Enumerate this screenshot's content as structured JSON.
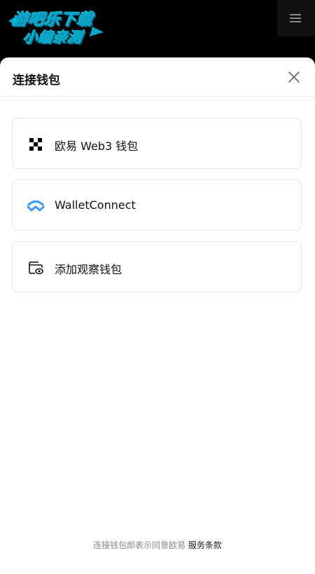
{
  "header": {
    "logo_line1": "游吧乐下载",
    "logo_line2": "小编亲测",
    "menu_icon": "hamburger-menu-icon"
  },
  "sheet": {
    "title": "连接钱包",
    "close_icon": "close-icon"
  },
  "options": [
    {
      "label": "欧易 Web3 钱包",
      "icon": "okx-logo-icon"
    },
    {
      "label": "WalletConnect",
      "icon": "walletconnect-icon",
      "icon_color": "#3b99fc"
    },
    {
      "label": "添加观察钱包",
      "icon": "watch-wallet-icon"
    }
  ],
  "footer": {
    "text": "连接钱包即表示同意欧易",
    "link": "服务条款"
  }
}
